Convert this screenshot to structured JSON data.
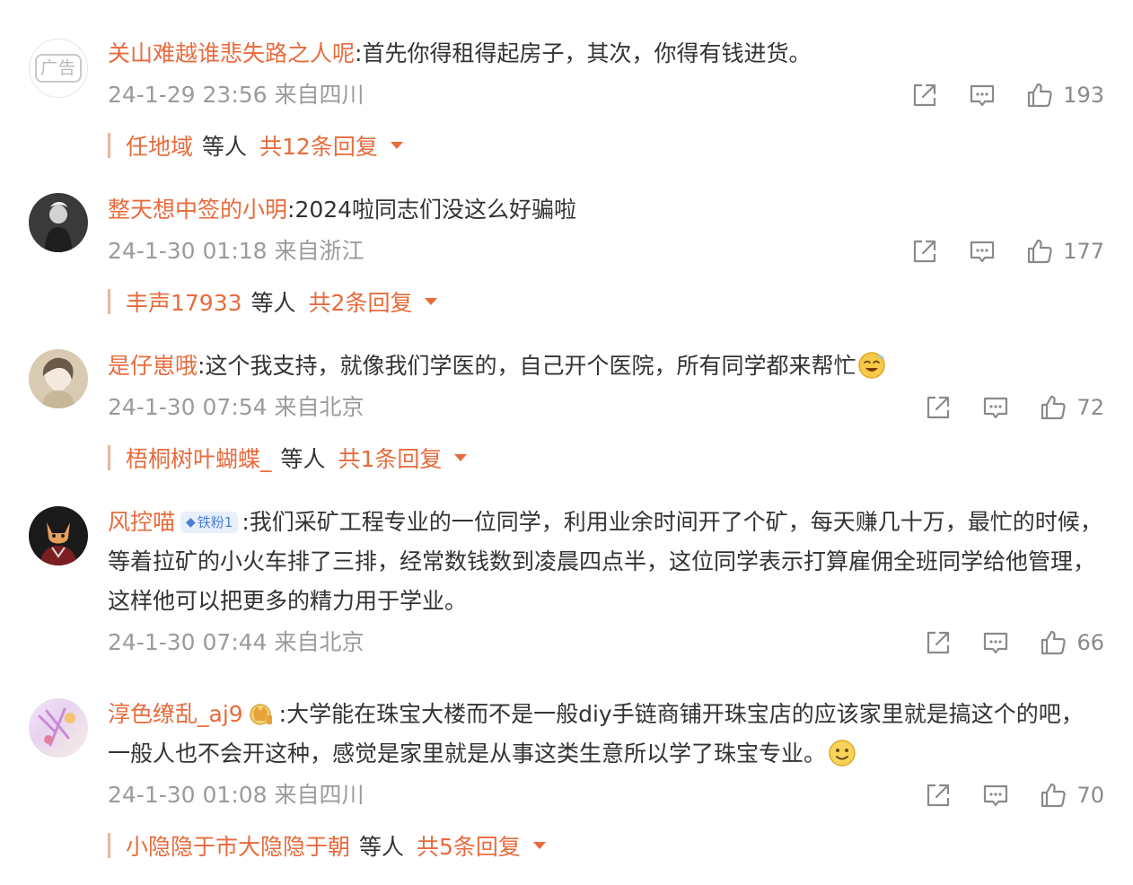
{
  "comments": [
    {
      "nickname": "关山难越谁悲失路之人呢",
      "text": ":首先你得租得起房子，其次，你得有钱进货。",
      "time": "24-1-29 23:56 来自四川",
      "likes": "193",
      "ad_label": "广告",
      "reply": {
        "name": "任地域",
        "etc": "等人",
        "count": "共12条回复"
      }
    },
    {
      "nickname": "整天想中签的小明",
      "text": ":2024啦同志们没这么好骗啦",
      "time": "24-1-30 01:18 来自浙江",
      "likes": "177",
      "reply": {
        "name": "丰声17933",
        "etc": "等人",
        "count": "共2条回复"
      }
    },
    {
      "nickname": "是仔崽哦",
      "text": ":这个我支持，就像我们学医的，自己开个医院，所有同学都来帮忙",
      "time": "24-1-30 07:54 来自北京",
      "likes": "72",
      "reply": {
        "name": "梧桐树叶蝴蝶_",
        "etc": "等人",
        "count": "共1条回复"
      }
    },
    {
      "nickname": "风控喵",
      "badge": "铁粉1",
      "text": ":我们采矿工程专业的一位同学，利用业余时间开了个矿，每天赚几十万，最忙的时候，等着拉矿的小火车排了三排，经常数钱数到凌晨四点半，这位同学表示打算雇佣全班同学给他管理，这样他可以把更多的精力用于学业。",
      "time": "24-1-30 07:44 来自北京",
      "likes": "66"
    },
    {
      "nickname": "淳色缭乱_aj9",
      "text": ":大学能在珠宝大楼而不是一般diy手链商铺开珠宝店的应该家里就是搞这个的吧，一般人也不会开这种，感觉是家里就是从事这类生意所以学了珠宝专业。",
      "time": "24-1-30 01:08 来自四川",
      "likes": "70",
      "reply": {
        "name": "小隐隐于市大隐隐于朝",
        "etc": "等人",
        "count": "共5条回复"
      }
    }
  ],
  "colors": {
    "nickname": "#e86b3c",
    "meta": "#9b9b9b",
    "reply_bar": "#e8b59f",
    "badge_bg": "#e8f0fb",
    "badge_text": "#4d7ed4"
  },
  "icons": {
    "share": "share-icon",
    "comment": "comment-icon",
    "like": "thumbs-up-icon",
    "expand": "caret-down-icon",
    "fan_badge": "diamond-icon",
    "vip": "crown-icon",
    "emoji": "smiley-emoji-icon"
  }
}
